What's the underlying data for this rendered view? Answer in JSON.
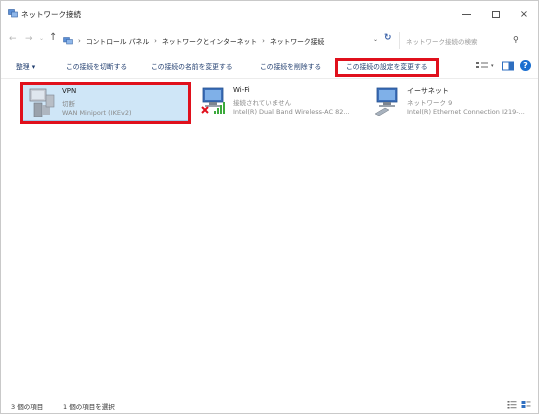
{
  "window": {
    "title": "ネットワーク接続",
    "icons": {
      "title": "network-connections-icon",
      "minimize": "minimize-icon",
      "maximize": "maximize-icon",
      "close": "close-icon",
      "close_glyph": "×"
    }
  },
  "address": {
    "back_glyph": "←",
    "forward_glyph": "→",
    "recent_glyph": "⌄",
    "up_glyph": "↑",
    "breadcrumb": [
      {
        "label": "›"
      },
      {
        "label": "コントロール パネル"
      },
      {
        "label": "ネットワークとインターネット"
      },
      {
        "label": "ネットワーク接続"
      }
    ],
    "separator": "›",
    "dropdown_glyph": "⌄",
    "refresh_glyph": "↻",
    "search_placeholder": "ネットワーク接続の検索",
    "search_glyph": "⚲"
  },
  "toolbar": {
    "organize": "整理 ▾",
    "disconnect": "この接続を切断する",
    "rename": "この接続の名前を変更する",
    "delete": "この接続を削除する",
    "change_settings": "この接続の設定を変更する",
    "view_dropdown_glyph": "▾",
    "help_glyph": "?"
  },
  "connections": [
    {
      "name": "VPN",
      "status": "切断",
      "device": "WAN Miniport (IKEv2)",
      "icon": "vpn-connection-icon",
      "selected": true
    },
    {
      "name": "Wi-Fi",
      "status": "接続されていません",
      "device": "Intel(R) Dual Band Wireless-AC 82...",
      "icon": "wifi-disconnected-icon",
      "selected": false
    },
    {
      "name": "イーサネット",
      "status": "ネットワーク 9",
      "device": "Intel(R) Ethernet Connection I219-...",
      "icon": "ethernet-icon",
      "selected": false
    }
  ],
  "status": {
    "item_count": "3 個の項目",
    "selected_count": "1 個の項目を選択"
  },
  "colors": {
    "highlight": "#e0101c",
    "selection": "#cfe6f7",
    "accent": "#1a6fd0"
  }
}
